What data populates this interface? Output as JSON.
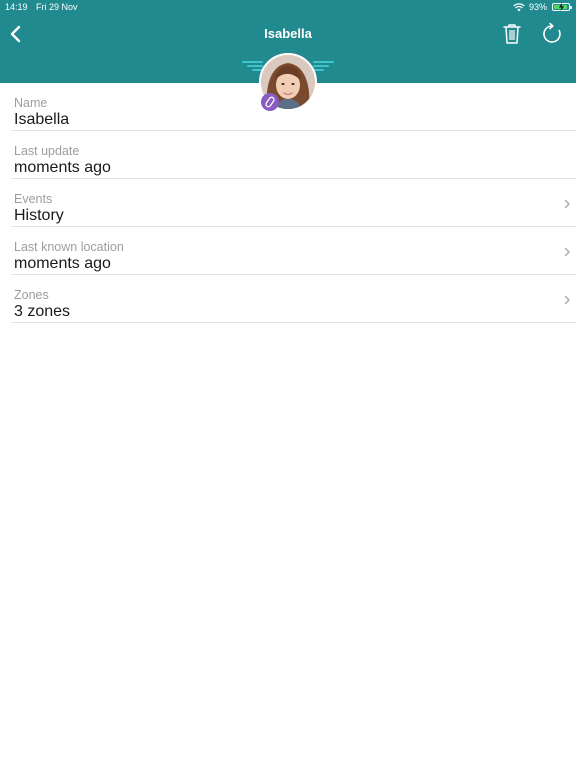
{
  "status_bar": {
    "time": "14:19",
    "date": "Fri 29 Nov",
    "battery_percent": "93%",
    "battery_level": 0.93
  },
  "nav": {
    "title": "Isabella",
    "back_icon": "chevron-left-icon",
    "delete_icon": "trash-icon",
    "refresh_icon": "refresh-icon"
  },
  "profile": {
    "avatar_icon": "user-photo",
    "badge_icon": "link-icon"
  },
  "rows": [
    {
      "label": "Name",
      "value": "Isabella"
    },
    {
      "label": "Last update",
      "value": "moments ago"
    },
    {
      "label": "Events",
      "value": "History"
    },
    {
      "label": "Last known location",
      "value": "moments ago"
    },
    {
      "label": "Zones",
      "value": "3 zones"
    }
  ],
  "colors": {
    "header": "#218a8e",
    "accent_wings": "#3fc3cf",
    "badge": "#8a5cc2"
  }
}
